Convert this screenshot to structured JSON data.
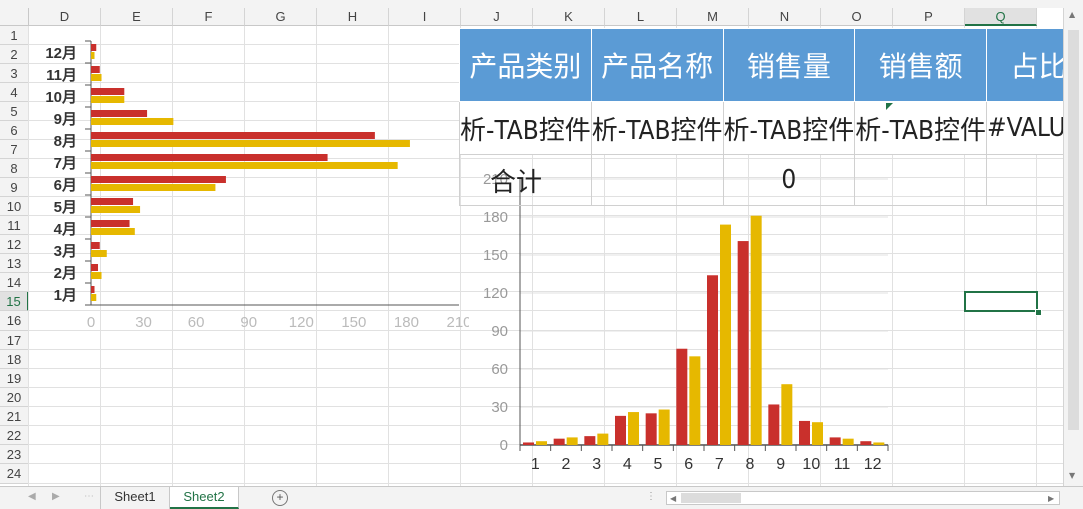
{
  "columns": [
    "D",
    "E",
    "F",
    "G",
    "H",
    "I",
    "J",
    "K",
    "L",
    "M",
    "N",
    "O",
    "P",
    "Q"
  ],
  "selected_column": "Q",
  "rows": [
    "1",
    "2",
    "3",
    "4",
    "5",
    "6",
    "7",
    "8",
    "9",
    "10",
    "11",
    "12",
    "13",
    "14",
    "15",
    "16",
    "17",
    "18",
    "19",
    "20",
    "21",
    "22",
    "23",
    "24"
  ],
  "selected_row": "15",
  "sheets": {
    "tab1": "Sheet1",
    "tab2": "Sheet2",
    "active": "Sheet2",
    "add": "+"
  },
  "table": {
    "headers": [
      "产品类别",
      "产品名称",
      "销售量",
      "销售额",
      "占比"
    ],
    "row1": [
      "析-TAB控件",
      "析-TAB控件",
      "析-TAB控件",
      "析-TAB控件",
      "#VALUE!"
    ],
    "row2_label": "合计",
    "row2_value": "0"
  },
  "colors": {
    "series1": "#c9302c",
    "series2": "#e6b800",
    "header_blue": "#5b9bd5",
    "excel_green": "#217346"
  },
  "chart_data": [
    {
      "type": "bar",
      "orientation": "horizontal",
      "categories": [
        "1月",
        "2月",
        "3月",
        "4月",
        "5月",
        "6月",
        "7月",
        "8月",
        "9月",
        "10月",
        "11月",
        "12月"
      ],
      "series": [
        {
          "values": [
            2,
            4,
            5,
            22,
            24,
            77,
            135,
            162,
            32,
            19,
            5,
            3
          ]
        },
        {
          "values": [
            3,
            6,
            9,
            25,
            28,
            71,
            175,
            182,
            47,
            19,
            6,
            2
          ]
        }
      ],
      "xticks": [
        "0",
        "30",
        "60",
        "90",
        "120",
        "150",
        "180",
        "210"
      ],
      "xlim": [
        0,
        210
      ],
      "grid": false
    },
    {
      "type": "bar",
      "orientation": "vertical",
      "categories": [
        "1",
        "2",
        "3",
        "4",
        "5",
        "6",
        "7",
        "8",
        "9",
        "10",
        "11",
        "12"
      ],
      "series": [
        {
          "values": [
            2,
            5,
            7,
            23,
            25,
            76,
            134,
            161,
            32,
            19,
            6,
            3
          ]
        },
        {
          "values": [
            3,
            6,
            9,
            26,
            28,
            70,
            174,
            181,
            48,
            18,
            5,
            2
          ]
        }
      ],
      "yticks": [
        "0",
        "30",
        "60",
        "90",
        "120",
        "150",
        "180",
        "210"
      ],
      "ylim": [
        0,
        210
      ],
      "grid": true
    }
  ]
}
